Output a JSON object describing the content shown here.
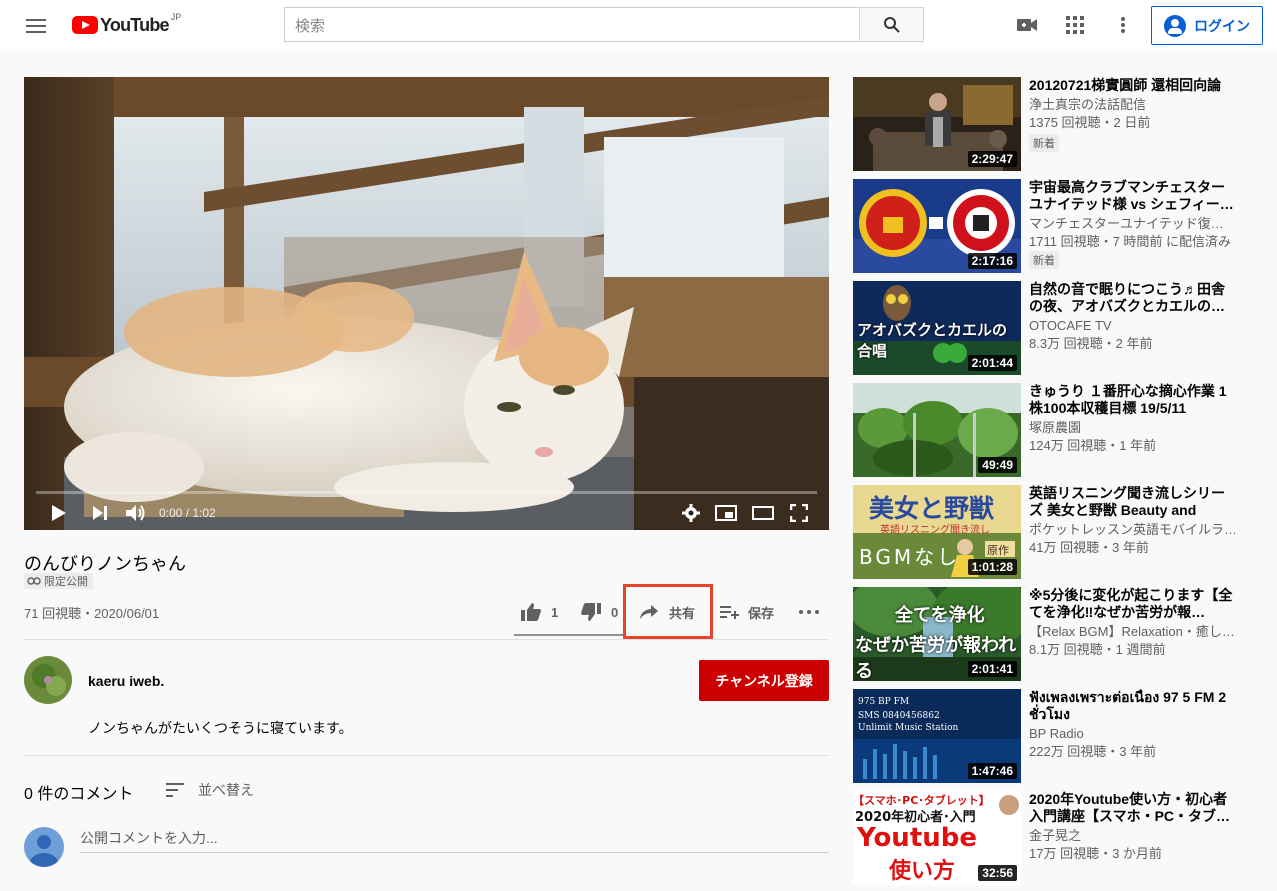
{
  "masthead": {
    "logo_text": "YouTube",
    "country": "JP",
    "search_placeholder": "検索",
    "login_label": "ログイン"
  },
  "player": {
    "time": "0:00 / 1:02",
    "progress_fraction": 0
  },
  "video": {
    "title": "のんびりノンちゃん",
    "badge": "限定公開",
    "views_date": "71 回視聴・2020/06/01",
    "likes": "1",
    "dislikes": "0",
    "share_label": "共有",
    "save_label": "保存"
  },
  "channel": {
    "name": "kaeru iweb.",
    "subscribe_label": "チャンネル登録",
    "description": "ノンちゃんがたいくつそうに寝ています。"
  },
  "comments": {
    "count_label": "0 件のコメント",
    "sort_label": "並べ替え",
    "input_placeholder": "公開コメントを入力..."
  },
  "recommendations": [
    {
      "title": "20120721梯實圓師 還相回向論",
      "channel": "浄土真宗の法話配信",
      "meta": "1375 回視聴・2 日前",
      "badge": "新着",
      "duration": "2:29:47"
    },
    {
      "title": "宇宙最高クラブマンチェスターユナイテッド様 vs シェフィー…",
      "channel": "マンチェスターユナイテッド復…",
      "meta": "1711 回視聴・7 時間前 に配信済み",
      "badge": "新着",
      "duration": "2:17:16"
    },
    {
      "title": "自然の音で眠りにつこう♬田舎の夜、アオバズクとカエルの…",
      "channel": "OTOCAFE TV",
      "meta": "8.3万 回視聴・2 年前",
      "badge": "",
      "duration": "2:01:44",
      "thumb_text": "アオバズクとカエルの合唱"
    },
    {
      "title": "きゅうり １番肝心な摘心作業 1株100本収穫目標 19/5/11",
      "channel": "塚原農園",
      "meta": "124万 回視聴・1 年前",
      "badge": "",
      "duration": "49:49"
    },
    {
      "title": "英語リスニング聞き流しシリーズ 美女と野獣 Beauty and Bea…",
      "channel": "ポケットレッスン英語モバイルラ…",
      "meta": "41万 回視聴・3 年前",
      "badge": "",
      "duration": "1:01:28",
      "thumb_text_1": "美女と野獣",
      "thumb_text_2": "英語リスニング聞き流し",
      "thumb_text_3": "BGMなし",
      "thumb_text_4": "原作"
    },
    {
      "title": "※5分後に変化が起こります【全てを浄化‼なぜか苦労が報…",
      "channel": "【Relax BGM】Relaxation・癒し…",
      "meta": "8.1万 回視聴・1 週間前",
      "badge": "",
      "duration": "2:01:41",
      "thumb_text_1": "全てを浄化",
      "thumb_text_2": "なぜか苦労が報われる"
    },
    {
      "title": "ฟังเพลงเพราะต่อเนื่อง 97 5 FM 2 ชั่วโมง",
      "channel": "BP Radio",
      "meta": "222万 回視聴・3 年前",
      "badge": "",
      "duration": "1:47:46",
      "thumb_text_1": "975 BP FM",
      "thumb_text_2": "SMS 0840456862",
      "thumb_text_3": "Unlimit Music Station"
    },
    {
      "title": "2020年Youtube使い方・初心者入門講座【スマホ・PC・タブ…",
      "channel": "金子晃之",
      "meta": "17万 回視聴・3 か月前",
      "badge": "",
      "duration": "32:56",
      "thumb_text_1": "【スマホ･PC･タブレット】",
      "thumb_text_2": "2020年初心者･入門",
      "thumb_text_3": "Youtube",
      "thumb_text_4": "使い方"
    }
  ],
  "colors": {
    "brand_red": "#ff0000",
    "accent_blue": "#065fd4",
    "subscribe_red": "#cc0000",
    "highlight_box": "#e5432a"
  }
}
